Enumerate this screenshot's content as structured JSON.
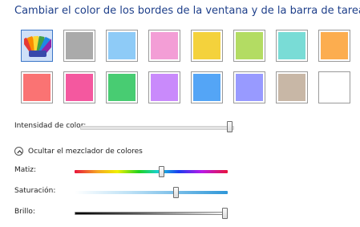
{
  "heading": "Cambiar el color de los bordes de la ventana y de la barra de tareas",
  "swatches_row1": [
    {
      "name": "automatic",
      "color": "automatic",
      "icon": "rainbow-palette-icon",
      "selected": true
    },
    {
      "name": "gray",
      "color": "#aaaaaa"
    },
    {
      "name": "sky-blue",
      "color": "#8ecbf7"
    },
    {
      "name": "pink",
      "color": "#f39ed6"
    },
    {
      "name": "yellow",
      "color": "#f4d23c"
    },
    {
      "name": "lime",
      "color": "#b3dc63"
    },
    {
      "name": "teal",
      "color": "#79dcd6"
    },
    {
      "name": "orange",
      "color": "#fcad4f"
    }
  ],
  "swatches_row2": [
    {
      "name": "red",
      "color": "#fa7373"
    },
    {
      "name": "magenta",
      "color": "#f4589f"
    },
    {
      "name": "green",
      "color": "#48cc72"
    },
    {
      "name": "violet",
      "color": "#c98afb"
    },
    {
      "name": "blue",
      "color": "#54a5f6"
    },
    {
      "name": "periwinkle",
      "color": "#989aff"
    },
    {
      "name": "taupe",
      "color": "#c8b7a6"
    },
    {
      "name": "white",
      "color": "#ffffff"
    }
  ],
  "intensity": {
    "label": "Intensidad de color:",
    "value": 0.98
  },
  "mixer_toggle": {
    "label": "Ocultar el mezclador de colores",
    "icon": "chevron-up-icon"
  },
  "hue": {
    "label": "Matiz:",
    "value": 0.57
  },
  "saturation": {
    "label": "Saturación:",
    "value": 0.66
  },
  "brightness": {
    "label": "Brillo:",
    "value": 0.98
  }
}
